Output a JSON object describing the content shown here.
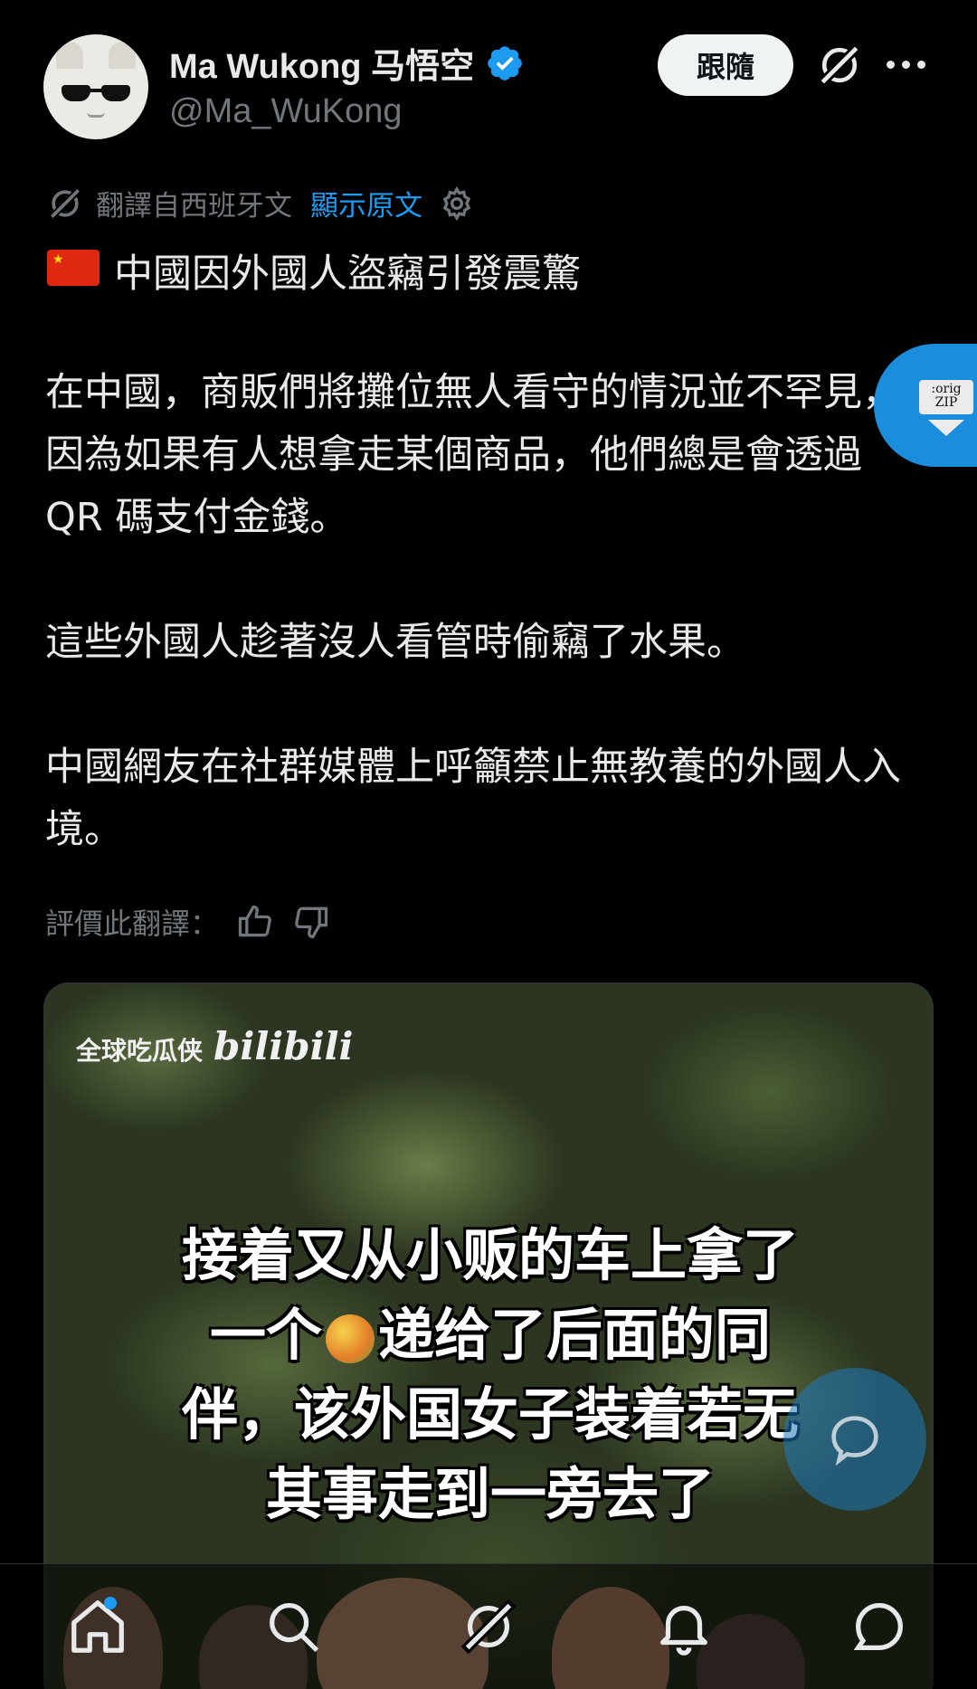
{
  "author": {
    "display_name": "Ma Wukong 马悟空",
    "handle": "@Ma_WuKong",
    "verified": true,
    "follow_label": "跟隨"
  },
  "translation": {
    "label": "翻譯自西班牙文",
    "show_original": "顯示原文",
    "rate_label": "評價此翻譯："
  },
  "tweet": {
    "title": "中國因外國人盜竊引發震驚",
    "paragraphs": [
      "在中國，商販們將攤位無人看守的情況並不罕見，因為如果有人想拿走某個商品，他們總是會透過 QR 碼支付金錢。",
      "這些外國人趁著沒人看管時偷竊了水果。",
      "中國網友在社群媒體上呼籲禁止無教養的外國人入境。"
    ]
  },
  "overlay": {
    "orig_zip": ":orig ZIP"
  },
  "media": {
    "channel": "全球吃瓜侠",
    "platform": "bilibili",
    "subtitle_lines": [
      "接着又从小贩的车上拿了",
      "一个",
      "递给了后面的同",
      "伴，该外国女子装着若无",
      "其事走到一旁去了"
    ]
  },
  "icons": {
    "verified": "verified-badge-icon",
    "grok": "grok-icon",
    "more": "more-icon",
    "translate": "translate-icon",
    "settings": "gear-icon",
    "thumbs_up": "thumbs-up-icon",
    "thumbs_down": "thumbs-down-icon",
    "reply": "reply-icon",
    "nav": [
      "home-icon",
      "search-icon",
      "grok-icon",
      "bell-icon",
      "messages-icon"
    ]
  },
  "colors": {
    "accent": "#1d9bf0",
    "text": "#e7e9ea",
    "muted": "#71767b",
    "background": "#000000"
  }
}
